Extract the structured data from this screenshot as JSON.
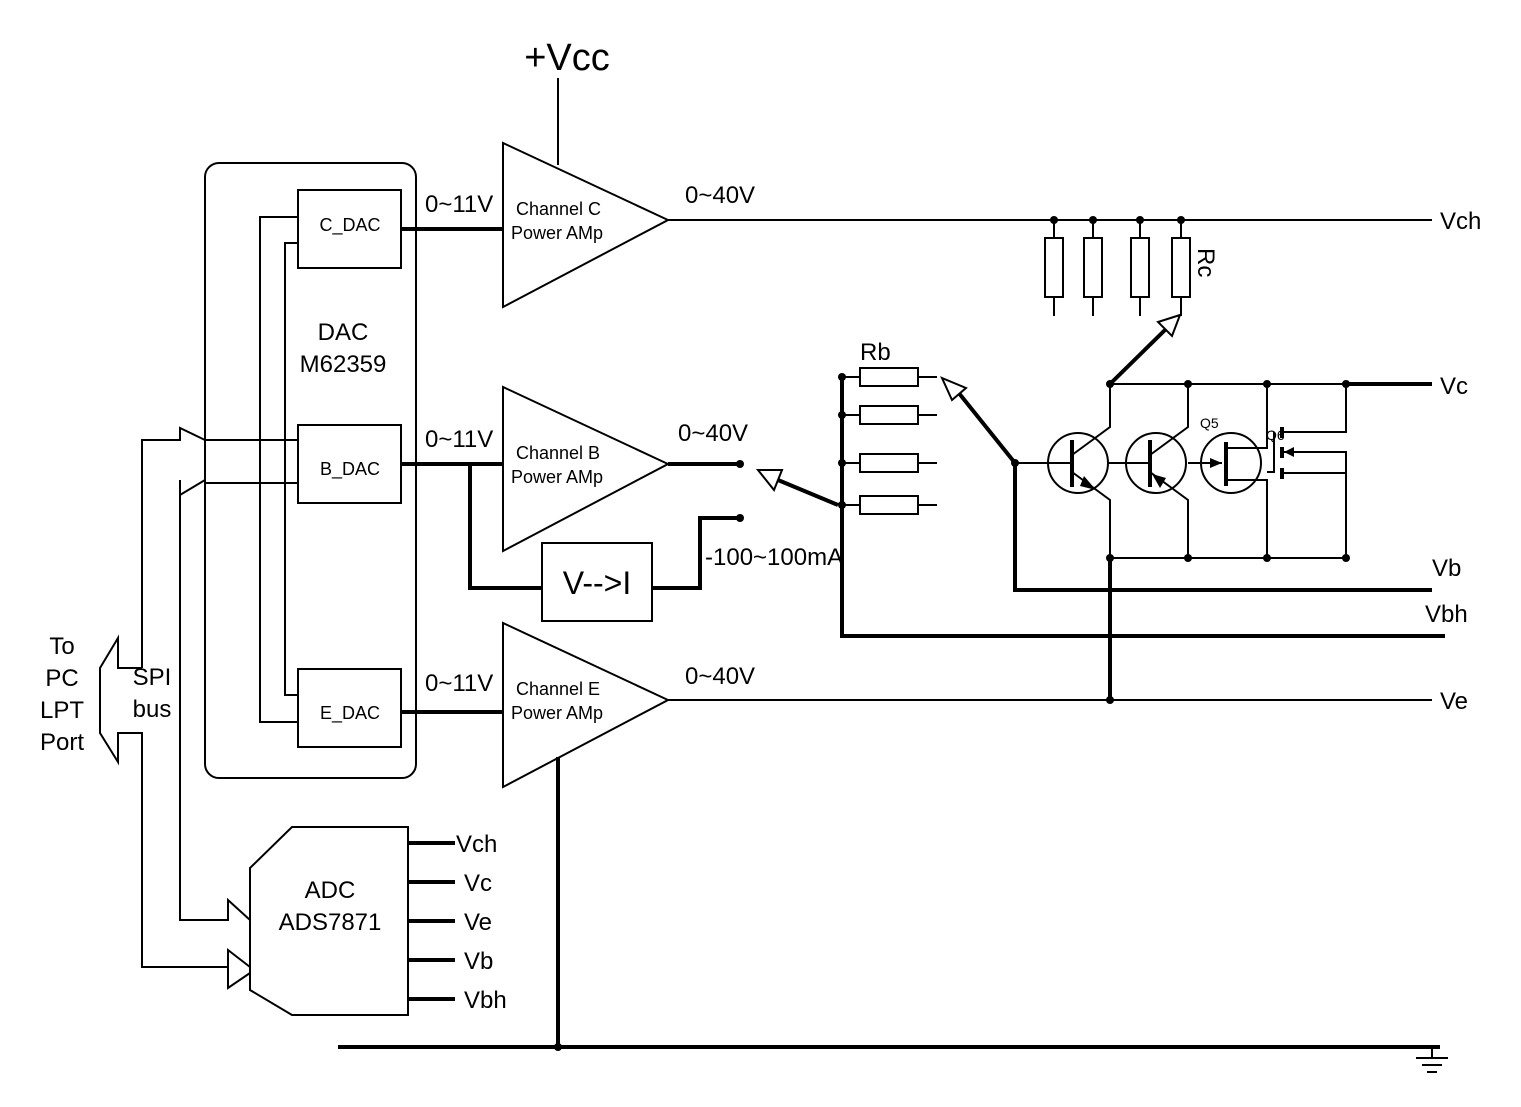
{
  "supply": "+Vcc",
  "dac": {
    "title": "DAC",
    "part": "M62359",
    "blocks": [
      "C_DAC",
      "B_DAC",
      "E_DAC"
    ]
  },
  "dac_out": "0~11V",
  "amps": [
    {
      "line1": "Channel C",
      "line2": "Power AMp",
      "out": "0~40V"
    },
    {
      "line1": "Channel B",
      "line2": "Power AMp",
      "out": "0~40V"
    },
    {
      "line1": "Channel E",
      "line2": "Power AMp",
      "out": "0~40V"
    }
  ],
  "converter": {
    "label": "V-->I",
    "range": "-100~100mA"
  },
  "bus": {
    "label1": "SPI",
    "label2": "bus",
    "port": [
      "To",
      "PC",
      "LPT",
      "Port"
    ]
  },
  "adc": {
    "title": "ADC",
    "part": "ADS7871",
    "inputs": [
      "Vch",
      "Vc",
      "Ve",
      "Vb",
      "Vbh"
    ]
  },
  "resistors": {
    "base": "Rb",
    "collector": "Rc"
  },
  "transistors": [
    "Q5",
    "Q6"
  ],
  "rails": {
    "vch": "Vch",
    "vc": "Vc",
    "vb": "Vb",
    "vbh": "Vbh",
    "ve": "Ve"
  }
}
